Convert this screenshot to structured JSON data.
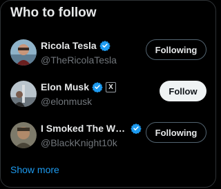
{
  "widget": {
    "title": "Who to follow",
    "show_more": "Show more"
  },
  "accounts": [
    {
      "name": "Ricola Tesla",
      "handle": "@TheRicolaTesla",
      "verified": true,
      "button": "Following",
      "button_state": "following"
    },
    {
      "name": "Elon Musk",
      "handle": "@elonmusk",
      "verified": true,
      "affiliation_badge": "X",
      "button": "Follow",
      "button_state": "not-following"
    },
    {
      "name": "I Smoked The W…",
      "handle": "@BlackKnight10k",
      "verified": true,
      "button": "Following",
      "button_state": "following"
    }
  ],
  "colors": {
    "background": "#000000",
    "accent": "#1d9bf0",
    "text": "#e7e9ea",
    "muted": "#71767b"
  }
}
